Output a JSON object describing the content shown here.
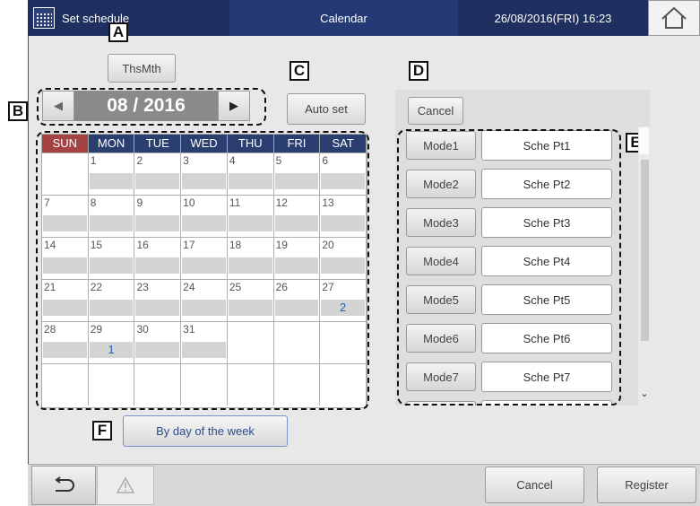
{
  "header": {
    "title": "Set schedule",
    "screen_name": "Calendar",
    "datetime": "26/08/2016(FRI) 16:23",
    "home_icon": "home-icon",
    "calendar_icon": "calendar-icon"
  },
  "callouts": {
    "a": "A",
    "b": "B",
    "c": "C",
    "d": "D",
    "e": "E",
    "f": "F"
  },
  "buttons": {
    "this_month": "ThsMth",
    "auto_set": "Auto set",
    "cancel_top": "Cancel",
    "by_day_of_week": "By day of the week",
    "cancel": "Cancel",
    "register": "Register"
  },
  "month_nav": {
    "label": "08 / 2016",
    "prev_icon": "left-triangle-icon",
    "next_icon": "right-triangle-icon"
  },
  "calendar": {
    "weekdays": [
      "SUN",
      "MON",
      "TUE",
      "WED",
      "THU",
      "FRI",
      "SAT"
    ],
    "weeks": [
      [
        {
          "d": "",
          "v": ""
        },
        {
          "d": "1",
          "v": ""
        },
        {
          "d": "2",
          "v": ""
        },
        {
          "d": "3",
          "v": ""
        },
        {
          "d": "4",
          "v": ""
        },
        {
          "d": "5",
          "v": ""
        },
        {
          "d": "6",
          "v": ""
        }
      ],
      [
        {
          "d": "7",
          "v": ""
        },
        {
          "d": "8",
          "v": ""
        },
        {
          "d": "9",
          "v": ""
        },
        {
          "d": "10",
          "v": ""
        },
        {
          "d": "11",
          "v": ""
        },
        {
          "d": "12",
          "v": ""
        },
        {
          "d": "13",
          "v": ""
        }
      ],
      [
        {
          "d": "14",
          "v": ""
        },
        {
          "d": "15",
          "v": ""
        },
        {
          "d": "16",
          "v": ""
        },
        {
          "d": "17",
          "v": ""
        },
        {
          "d": "18",
          "v": ""
        },
        {
          "d": "19",
          "v": ""
        },
        {
          "d": "20",
          "v": ""
        }
      ],
      [
        {
          "d": "21",
          "v": ""
        },
        {
          "d": "22",
          "v": ""
        },
        {
          "d": "23",
          "v": ""
        },
        {
          "d": "24",
          "v": ""
        },
        {
          "d": "25",
          "v": ""
        },
        {
          "d": "26",
          "v": ""
        },
        {
          "d": "27",
          "v": "2"
        }
      ],
      [
        {
          "d": "28",
          "v": ""
        },
        {
          "d": "29",
          "v": "1"
        },
        {
          "d": "30",
          "v": ""
        },
        {
          "d": "31",
          "v": ""
        },
        {
          "d": "",
          "v": ""
        },
        {
          "d": "",
          "v": ""
        },
        {
          "d": "",
          "v": ""
        }
      ],
      [
        {
          "d": "",
          "v": ""
        },
        {
          "d": "",
          "v": ""
        },
        {
          "d": "",
          "v": ""
        },
        {
          "d": "",
          "v": ""
        },
        {
          "d": "",
          "v": ""
        },
        {
          "d": "",
          "v": ""
        },
        {
          "d": "",
          "v": ""
        }
      ]
    ]
  },
  "modes": [
    {
      "mode": "Mode1",
      "pattern": "Sche Pt1"
    },
    {
      "mode": "Mode2",
      "pattern": "Sche Pt2"
    },
    {
      "mode": "Mode3",
      "pattern": "Sche Pt3"
    },
    {
      "mode": "Mode4",
      "pattern": "Sche Pt4"
    },
    {
      "mode": "Mode5",
      "pattern": "Sche Pt5"
    },
    {
      "mode": "Mode6",
      "pattern": "Sche Pt6"
    },
    {
      "mode": "Mode7",
      "pattern": "Sche Pt7"
    },
    {
      "mode": "",
      "pattern": ""
    }
  ],
  "footer": {
    "back_icon": "return-arrow-icon",
    "warning_icon": "warning-icon"
  },
  "colors": {
    "header": "#1f2f60",
    "sunday": "#a54242",
    "weekday_header": "#2a3f70",
    "value_text": "#2b5db3"
  }
}
